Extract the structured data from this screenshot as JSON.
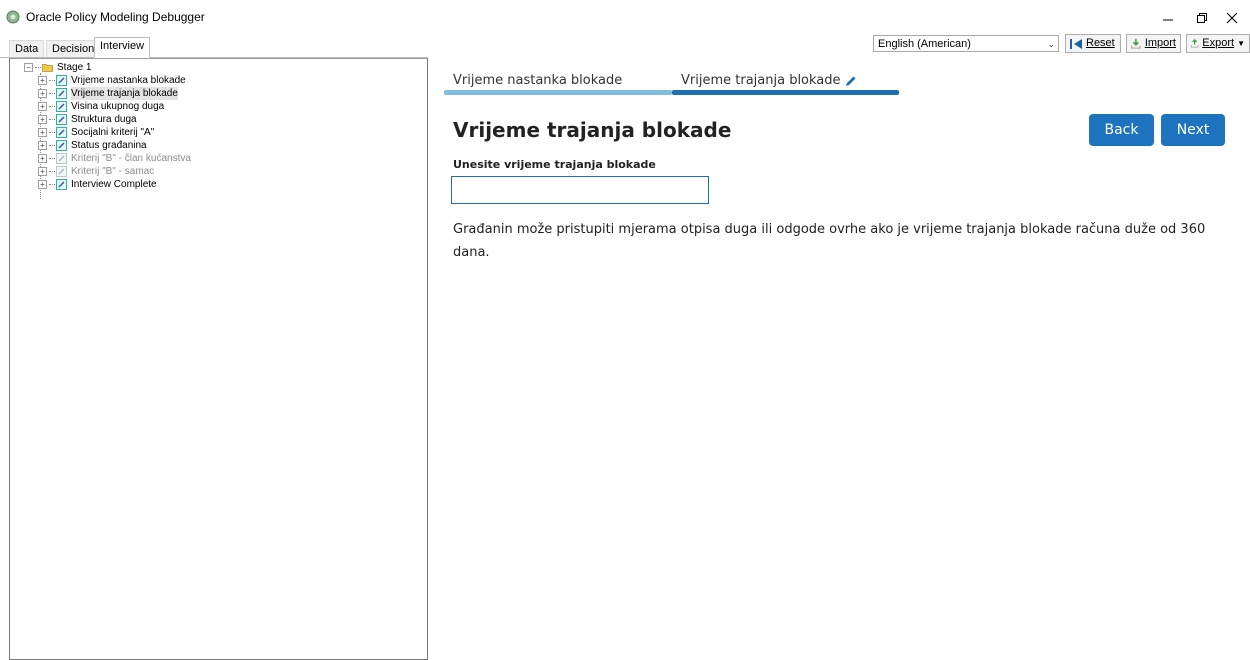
{
  "window": {
    "title": "Oracle Policy Modeling Debugger",
    "controls": [
      "minimize",
      "restore",
      "close"
    ]
  },
  "tabs": [
    {
      "label": "Data",
      "active": false
    },
    {
      "label": "Decision",
      "active": false
    },
    {
      "label": "Interview",
      "active": true
    }
  ],
  "toolbar": {
    "language": "English (American)",
    "reset_label": "Reset",
    "import_label": "Import",
    "export_label": "Export"
  },
  "tree": {
    "root": "Stage 1",
    "items": [
      {
        "label": "Vrijeme nastanka blokade",
        "state": "normal"
      },
      {
        "label": "Vrijeme trajanja blokade",
        "state": "selected"
      },
      {
        "label": "Visina ukupnog duga",
        "state": "normal"
      },
      {
        "label": "Struktura duga",
        "state": "normal"
      },
      {
        "label": "Socijalni kriterij \"A\"",
        "state": "normal"
      },
      {
        "label": "Status građanina",
        "state": "normal"
      },
      {
        "label": "Kriterij \"B\" - član kućanstva",
        "state": "disabled"
      },
      {
        "label": "Kriterij \"B\" - samac",
        "state": "disabled"
      },
      {
        "label": "Interview Complete",
        "state": "normal"
      }
    ]
  },
  "interview": {
    "steps": [
      {
        "label": "Vrijeme nastanka blokade",
        "status": "completed"
      },
      {
        "label": "Vrijeme trajanja blokade",
        "status": "current"
      }
    ],
    "page_title": "Vrijeme trajanja blokade",
    "back_label": "Back",
    "next_label": "Next",
    "field_label": "Unesite vrijeme trajanja blokade",
    "field_value": "",
    "info_text": "Građanin može pristupiti mjerama otpisa duga ili odgode ovrhe ako je vrijeme trajanja blokade računa duže od 360 dana."
  },
  "colors": {
    "accent": "#1e73be",
    "progress_completed": "#7fbde3",
    "progress_current": "#1e6fb2"
  }
}
